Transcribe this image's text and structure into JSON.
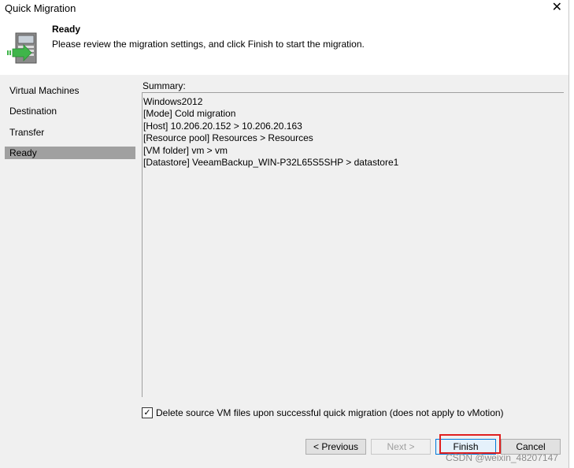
{
  "window": {
    "title": "Quick Migration"
  },
  "header": {
    "title": "Ready",
    "description": "Please review the migration settings, and click Finish to start the migration.",
    "icon": "server-migration-icon"
  },
  "nav": {
    "items": [
      {
        "label": "Virtual Machines"
      },
      {
        "label": "Destination"
      },
      {
        "label": "Transfer"
      },
      {
        "label": "Ready"
      }
    ],
    "active": "Ready"
  },
  "summary": {
    "label": "Summary:",
    "lines": [
      "Windows2012",
      "[Mode] Cold migration",
      "[Host] 10.206.20.152 > 10.206.20.163",
      "[Resource pool] Resources > Resources",
      "[VM folder] vm > vm",
      "[Datastore] VeeamBackup_WIN-P32L65S5SHP > datastore1"
    ]
  },
  "delete_source": {
    "label": "Delete source VM files upon successful quick migration (does not apply to vMotion)",
    "checked": true
  },
  "buttons": {
    "previous": "< Previous",
    "next": "Next >",
    "finish": "Finish",
    "cancel": "Cancel"
  },
  "watermark": "CSDN @weixin_48207147",
  "colors": {
    "highlight": "#e02020",
    "active_nav": "#a0a0a0",
    "panel": "#f0f0f0",
    "primary_border": "#0078d7"
  }
}
